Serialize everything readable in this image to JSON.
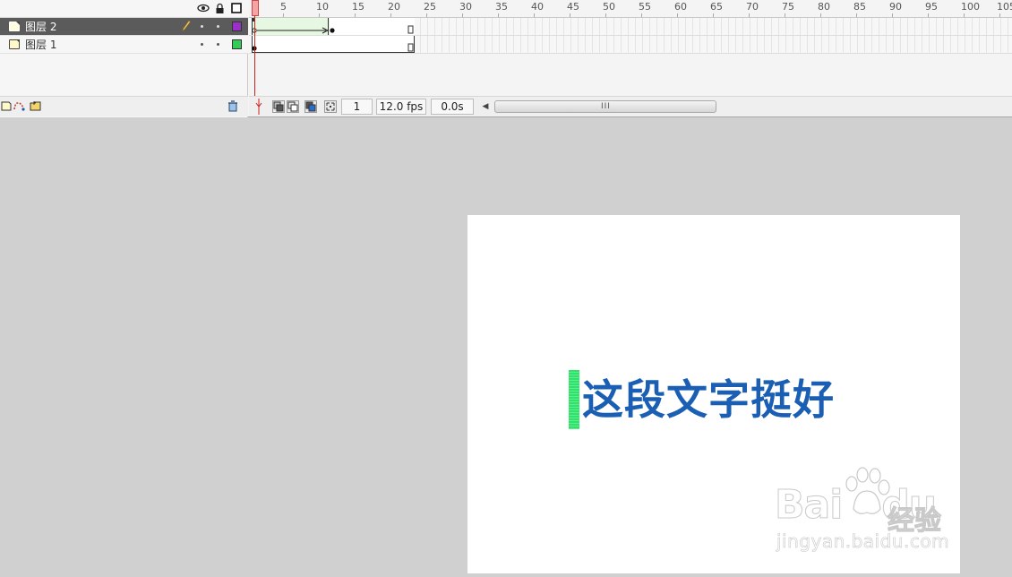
{
  "timeline": {
    "header_icons": [
      "eye-icon",
      "lock-icon",
      "outline-icon"
    ],
    "layers": [
      {
        "name": "图层 2",
        "selected": true,
        "color": "#9b30c8",
        "pencil": true
      },
      {
        "name": "图层 1",
        "selected": false,
        "color": "#33cc55",
        "pencil": false
      }
    ],
    "ruler_labels": [
      "1",
      "5",
      "10",
      "15",
      "20",
      "25",
      "30",
      "35",
      "40",
      "45",
      "50",
      "55",
      "60",
      "65",
      "70",
      "75",
      "80",
      "85",
      "90",
      "95",
      "100",
      "105"
    ],
    "current_frame": "1",
    "fps": "12.0 fps",
    "elapsed": "0.0s",
    "layer_toolbar_icons": [
      "insert-layer-icon",
      "add-motion-guide-icon",
      "insert-folder-icon",
      "delete-layer-icon"
    ],
    "frame_toolbar_icons": [
      "center-frame-icon",
      "onion-skin-icon",
      "onion-skin-outlines-icon",
      "edit-multiple-frames-icon",
      "modify-onion-markers-icon"
    ],
    "scroll_grip": "III"
  },
  "stage": {
    "text": "这段文字挺好",
    "text_color": "#1a5fb4",
    "cursor_color": "#2ee36a",
    "background": "#ffffff"
  },
  "watermark": {
    "logo": "Bai",
    "logo2": "du",
    "chinese": "经验",
    "url": "jingyan.baidu.com"
  }
}
